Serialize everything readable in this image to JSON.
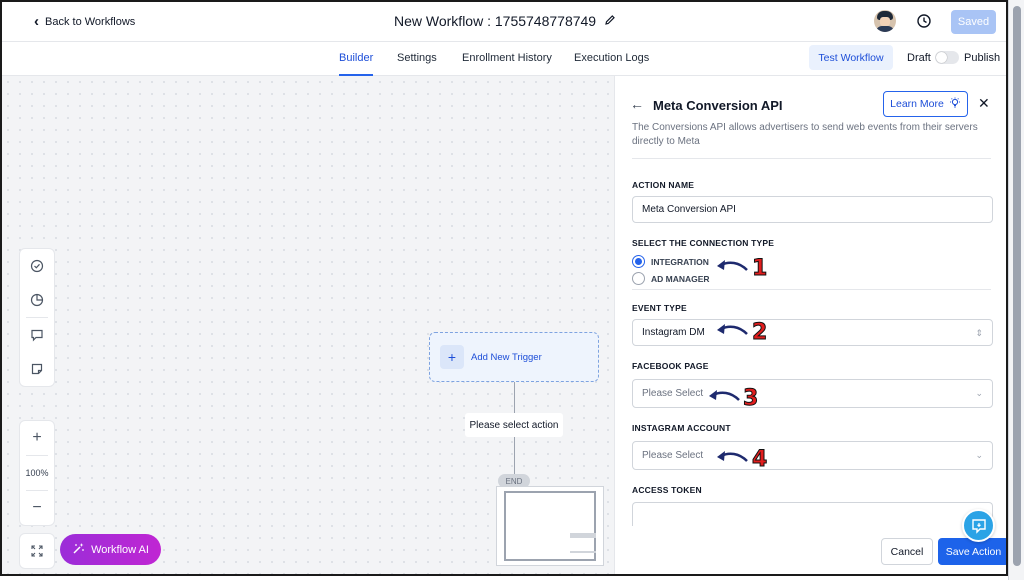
{
  "header": {
    "back_label": "Back to Workflows",
    "workflow_title": "New Workflow : 1755748778749",
    "saved_label": "Saved"
  },
  "tabs": [
    {
      "label": "Builder",
      "active": true
    },
    {
      "label": "Settings",
      "active": false
    },
    {
      "label": "Enrollment History",
      "active": false
    },
    {
      "label": "Execution Logs",
      "active": false
    }
  ],
  "toolbar": {
    "test_workflow_label": "Test Workflow",
    "draft_label": "Draft",
    "publish_label": "Publish",
    "publish_enabled": false
  },
  "canvas": {
    "zoom_label": "100%",
    "workflow_ai_label": "Workflow AI",
    "add_trigger_label": "Add New Trigger",
    "select_action_label": "Please select action",
    "end_label": "END"
  },
  "panel": {
    "title": "Meta Conversion API",
    "learn_more_label": "Learn More",
    "description": "The Conversions API allows advertisers to send web events from their servers directly to Meta",
    "action_name_label": "ACTION NAME",
    "action_name_value": "Meta Conversion API",
    "connection_type_label": "SELECT THE CONNECTION TYPE",
    "connection_options": [
      {
        "label": "INTEGRATION",
        "selected": true
      },
      {
        "label": "AD MANAGER",
        "selected": false
      }
    ],
    "event_type_label": "EVENT TYPE",
    "event_type_value": "Instagram DM",
    "facebook_page_label": "FACEBOOK PAGE",
    "facebook_page_placeholder": "Please Select",
    "instagram_account_label": "INSTAGRAM ACCOUNT",
    "instagram_account_placeholder": "Please Select",
    "access_token_label": "ACCESS TOKEN",
    "cancel_label": "Cancel",
    "save_label": "Save Action"
  },
  "annotations": [
    "1",
    "2",
    "3",
    "4"
  ],
  "colors": {
    "accent": "#2563eb",
    "saved_disabled": "#a9c4f5",
    "annotation_red": "#e11d1d",
    "annotation_arrow": "#1e2a6e",
    "workflow_ai_gradient": [
      "#9b2dd8",
      "#c026d3"
    ]
  }
}
